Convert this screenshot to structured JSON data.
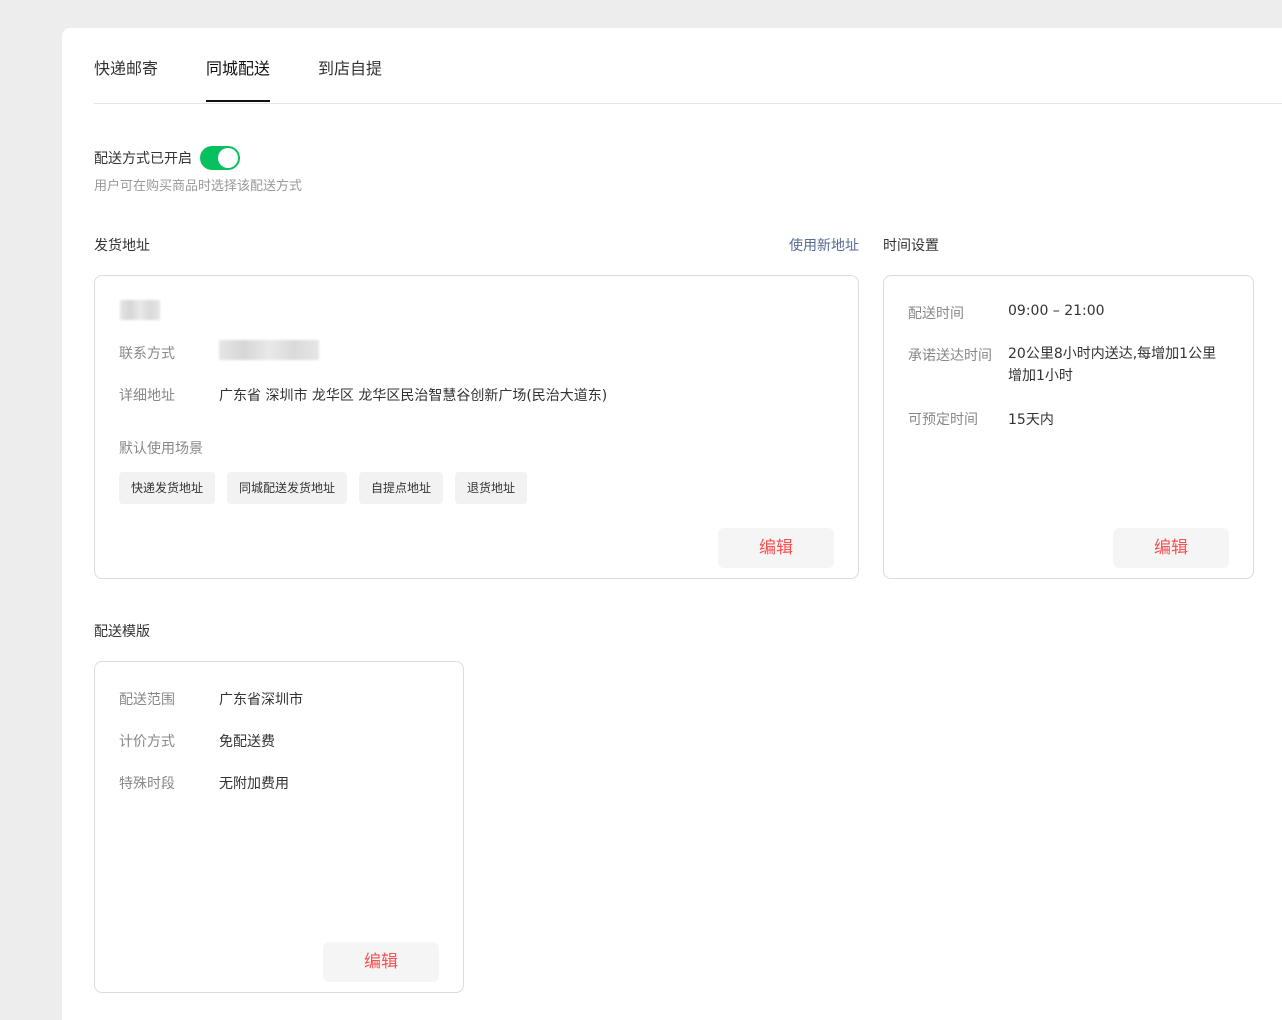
{
  "tabs": [
    "快递邮寄",
    "同城配送",
    "到店自提"
  ],
  "active_tab": "同城配送",
  "toggle": {
    "label": "配送方式已开启",
    "on": true,
    "hint": "用户可在购买商品时选择该配送方式"
  },
  "address": {
    "title": "发货地址",
    "new_link": "使用新地址",
    "contact_label": "联系方式",
    "detail_label": "详细地址",
    "detail_value": "广东省 深圳市 龙华区 龙华区民治智慧谷创新广场(民治大道东)",
    "scene_label": "默认使用场景",
    "tags": [
      "快递发货地址",
      "同城配送发货地址",
      "自提点地址",
      "退货地址"
    ],
    "edit": "编辑"
  },
  "time": {
    "title": "时间设置",
    "rows": [
      {
        "k": "配送时间",
        "v": "09:00 – 21:00"
      },
      {
        "k": "承诺送达时间",
        "v": "20公里8小时内送达,每增加1公里增加1小时"
      },
      {
        "k": "可预定时间",
        "v": "15天内"
      }
    ],
    "edit": "编辑"
  },
  "template": {
    "title": "配送模版",
    "rows": [
      {
        "k": "配送范围",
        "v": "广东省深圳市"
      },
      {
        "k": "计价方式",
        "v": "免配送费"
      },
      {
        "k": "特殊时段",
        "v": "无附加费用"
      }
    ],
    "edit": "编辑"
  },
  "colors": {
    "accent_green": "#07c160",
    "edit_red": "#fa5151",
    "link_blue": "#576b95"
  }
}
